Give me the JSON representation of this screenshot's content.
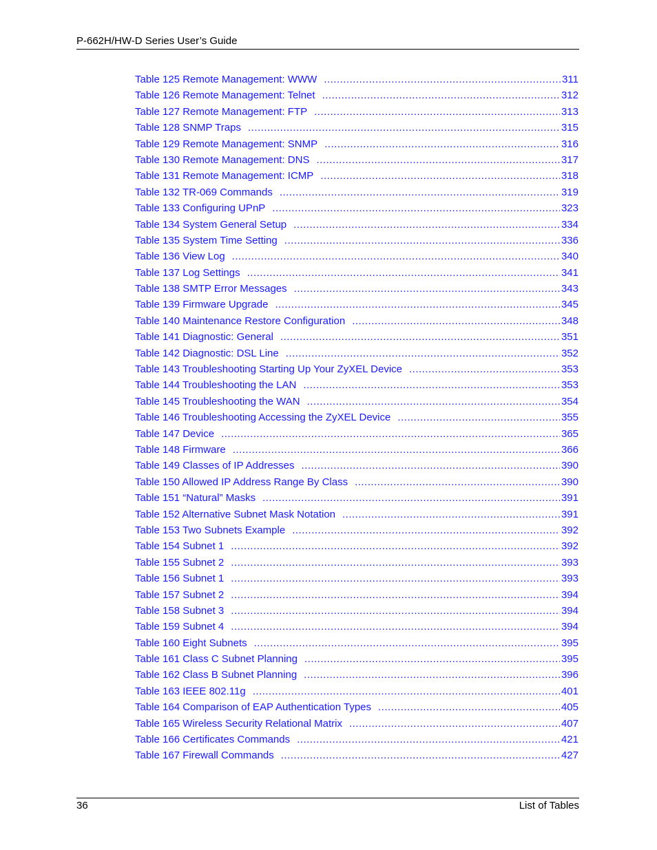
{
  "header": {
    "title": "P-662H/HW-D Series User’s Guide"
  },
  "toc": {
    "entries": [
      {
        "label": "Table 125 Remote Management: WWW",
        "page": "311"
      },
      {
        "label": "Table 126 Remote Management: Telnet",
        "page": "312"
      },
      {
        "label": "Table 127 Remote Management: FTP",
        "page": "313"
      },
      {
        "label": "Table 128 SNMP Traps",
        "page": "315"
      },
      {
        "label": "Table 129 Remote Management: SNMP",
        "page": "316"
      },
      {
        "label": "Table 130 Remote Management: DNS",
        "page": "317"
      },
      {
        "label": "Table 131 Remote Management: ICMP",
        "page": "318"
      },
      {
        "label": "Table 132 TR-069 Commands",
        "page": "319"
      },
      {
        "label": "Table 133 Configuring UPnP",
        "page": "323"
      },
      {
        "label": "Table 134 System General Setup",
        "page": "334"
      },
      {
        "label": "Table 135 System Time Setting",
        "page": "336"
      },
      {
        "label": "Table 136 View Log",
        "page": "340"
      },
      {
        "label": "Table 137 Log Settings",
        "page": "341"
      },
      {
        "label": "Table 138 SMTP Error Messages",
        "page": "343"
      },
      {
        "label": "Table 139 Firmware Upgrade",
        "page": "345"
      },
      {
        "label": "Table 140 Maintenance Restore Configuration",
        "page": "348"
      },
      {
        "label": "Table 141 Diagnostic: General",
        "page": "351"
      },
      {
        "label": "Table 142 Diagnostic: DSL Line",
        "page": "352"
      },
      {
        "label": "Table 143 Troubleshooting Starting Up Your ZyXEL Device",
        "page": "353"
      },
      {
        "label": "Table 144 Troubleshooting the LAN",
        "page": "353"
      },
      {
        "label": "Table 145 Troubleshooting the WAN",
        "page": "354"
      },
      {
        "label": "Table 146 Troubleshooting Accessing the ZyXEL Device",
        "page": "355"
      },
      {
        "label": "Table 147 Device",
        "page": "365"
      },
      {
        "label": "Table 148 Firmware",
        "page": "366"
      },
      {
        "label": "Table 149 Classes of IP Addresses",
        "page": "390"
      },
      {
        "label": "Table 150 Allowed IP Address Range By Class",
        "page": "390"
      },
      {
        "label": "Table 151  “Natural” Masks",
        "page": "391"
      },
      {
        "label": "Table 152 Alternative Subnet Mask Notation",
        "page": "391"
      },
      {
        "label": "Table 153 Two Subnets Example",
        "page": "392"
      },
      {
        "label": "Table 154 Subnet 1",
        "page": "392"
      },
      {
        "label": "Table 155 Subnet 2",
        "page": "393"
      },
      {
        "label": "Table 156 Subnet 1",
        "page": "393"
      },
      {
        "label": "Table 157 Subnet 2",
        "page": "394"
      },
      {
        "label": "Table 158 Subnet 3",
        "page": "394"
      },
      {
        "label": "Table 159 Subnet 4",
        "page": "394"
      },
      {
        "label": "Table 160 Eight Subnets",
        "page": "395"
      },
      {
        "label": "Table 161 Class C Subnet Planning",
        "page": "395"
      },
      {
        "label": "Table 162 Class B Subnet Planning",
        "page": "396"
      },
      {
        "label": "Table 163 IEEE 802.11g",
        "page": "401"
      },
      {
        "label": "Table 164 Comparison of EAP Authentication Types",
        "page": "405"
      },
      {
        "label": "Table 165 Wireless Security Relational Matrix",
        "page": "407"
      },
      {
        "label": "Table 166 Certificates Commands",
        "page": "421"
      },
      {
        "label": "Table 167 Firewall Commands",
        "page": "427"
      }
    ]
  },
  "footer": {
    "page_number": "36",
    "section": "List of Tables"
  }
}
